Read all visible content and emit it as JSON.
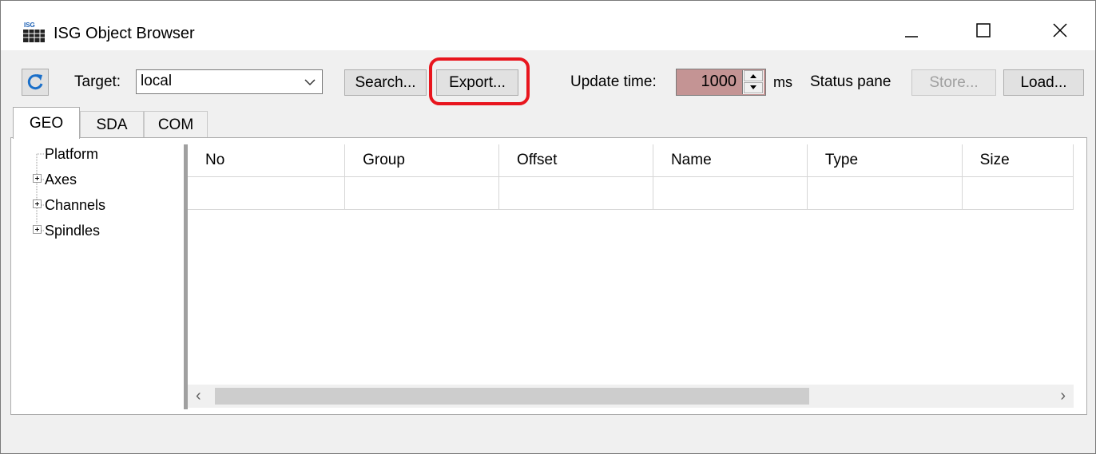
{
  "window": {
    "title": "ISG Object Browser",
    "icon_text": "ISG"
  },
  "toolbar": {
    "target_label": "Target:",
    "target_value": "local",
    "search_label": "Search...",
    "export_label": "Export...",
    "update_time_label": "Update time:",
    "update_time_value": "1000",
    "unit_label": "ms",
    "status_pane_label": "Status pane",
    "store_label": "Store...",
    "load_label": "Load..."
  },
  "tabs": [
    {
      "label": "GEO",
      "active": true
    },
    {
      "label": "SDA",
      "active": false
    },
    {
      "label": "COM",
      "active": false
    }
  ],
  "tree": [
    {
      "label": "Platform",
      "expandable": false
    },
    {
      "label": "Axes",
      "expandable": true
    },
    {
      "label": "Channels",
      "expandable": true
    },
    {
      "label": "Spindles",
      "expandable": true
    }
  ],
  "grid": {
    "columns": [
      "No",
      "Group",
      "Offset",
      "Name",
      "Type",
      "Size"
    ]
  },
  "colors": {
    "highlight": "#e8151d",
    "update_time_bg": "#c49494"
  }
}
